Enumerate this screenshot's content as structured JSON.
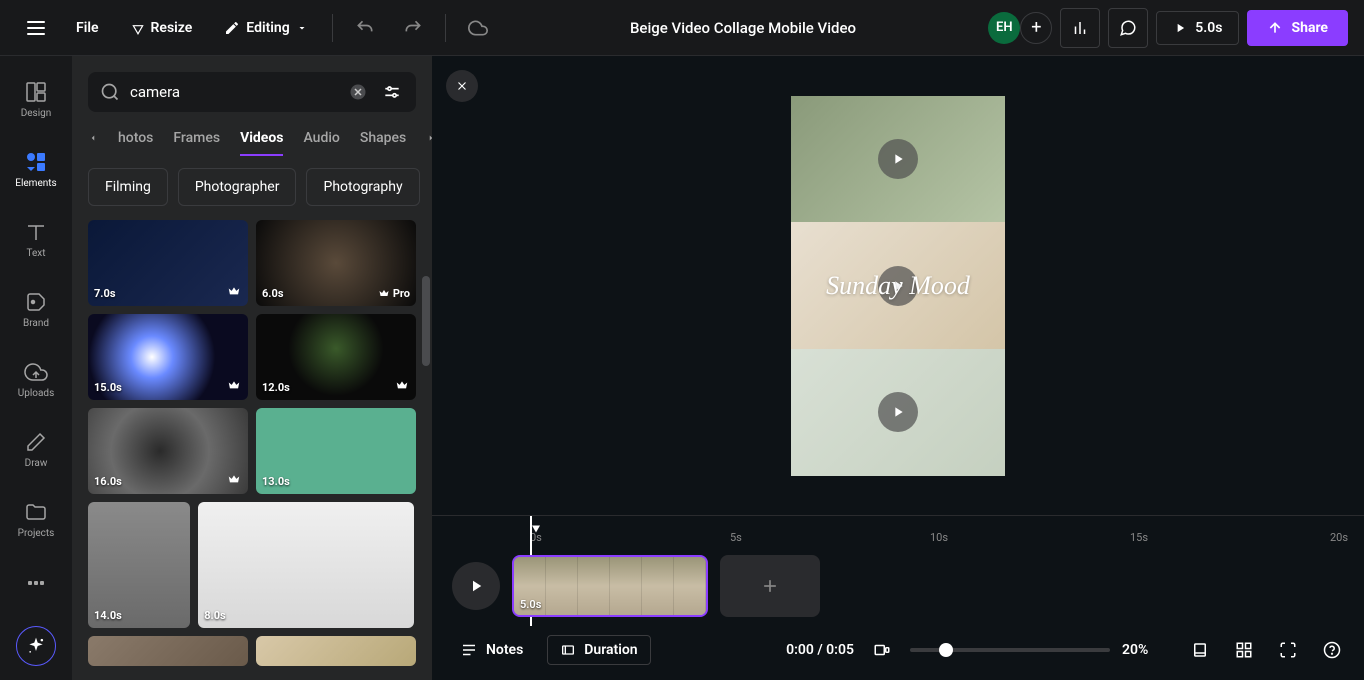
{
  "topbar": {
    "file": "File",
    "resize": "Resize",
    "editing": "Editing",
    "project_title": "Beige Video Collage Mobile Video",
    "avatar_initials": "EH",
    "play_duration": "5.0s",
    "share": "Share"
  },
  "leftnav": {
    "items": [
      {
        "label": "Design"
      },
      {
        "label": "Elements"
      },
      {
        "label": "Text"
      },
      {
        "label": "Brand"
      },
      {
        "label": "Uploads"
      },
      {
        "label": "Draw"
      },
      {
        "label": "Projects"
      }
    ]
  },
  "sidepanel": {
    "search_value": "camera",
    "tabs": [
      "hotos",
      "Frames",
      "Videos",
      "Audio",
      "Shapes"
    ],
    "active_tab": "Videos",
    "filter_chips": [
      "Filming",
      "Photographer",
      "Photography"
    ],
    "videos": [
      {
        "duration": "7.0s",
        "bg": "bg-dark-blue",
        "badge": "crown",
        "width": "half"
      },
      {
        "duration": "6.0s",
        "bg": "bg-lens-dark",
        "badge": "pro",
        "width": "half"
      },
      {
        "duration": "15.0s",
        "bg": "bg-flare",
        "badge": "crown",
        "width": "half"
      },
      {
        "duration": "12.0s",
        "bg": "bg-dark-green",
        "badge": "crown",
        "width": "half"
      },
      {
        "duration": "16.0s",
        "bg": "bg-lens-gray",
        "badge": "crown",
        "width": "half"
      },
      {
        "duration": "13.0s",
        "bg": "bg-green-screen",
        "badge": "",
        "width": "half"
      },
      {
        "duration": "14.0s",
        "bg": "bg-studio-gray",
        "badge": "",
        "width": "third"
      },
      {
        "duration": "8.0s",
        "bg": "bg-white-photog",
        "badge": "",
        "width": "twothird"
      },
      {
        "duration": "",
        "bg": "bg-office",
        "badge": "",
        "width": "half"
      },
      {
        "duration": "",
        "bg": "bg-tan",
        "badge": "",
        "width": "half"
      }
    ]
  },
  "canvas": {
    "overlay_text": "Sunday Mood"
  },
  "timeline": {
    "ruler": [
      {
        "label": "0s",
        "pos": 98
      },
      {
        "label": "5s",
        "pos": 298
      },
      {
        "label": "10s",
        "pos": 498
      },
      {
        "label": "15s",
        "pos": 698
      },
      {
        "label": "20s",
        "pos": 898
      }
    ],
    "clip_duration": "5.0s"
  },
  "bottombar": {
    "notes": "Notes",
    "duration": "Duration",
    "time": "0:00 / 0:05",
    "zoom": "20%"
  }
}
